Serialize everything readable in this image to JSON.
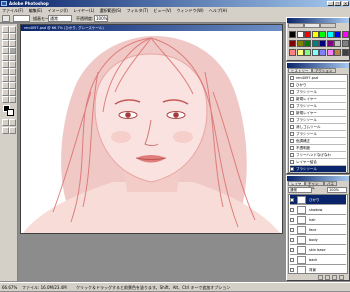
{
  "window": {
    "title": "Adobe Photoshop"
  },
  "menu": [
    "ファイル(F)",
    "編集(E)",
    "イメージ(I)",
    "レイヤー(L)",
    "選択範囲(S)",
    "フィルタ(T)",
    "ビュー(V)",
    "ウィンドウ(W)",
    "ヘルプ(H)"
  ],
  "options": {
    "mode_label": "描画モード:",
    "mode_value": "通常",
    "opacity_label": "不透明度:",
    "opacity_value": "100%"
  },
  "document": {
    "title": "ren4097.psd @ 66.7% (ひかり, グレースケール)"
  },
  "swatches": [
    "#000000",
    "#ffffff",
    "#ff0000",
    "#ffff00",
    "#00ff00",
    "#00ffff",
    "#0000ff",
    "#ff00ff",
    "#800000",
    "#808000",
    "#008000",
    "#008080",
    "#000080",
    "#800080",
    "#c0c0c0",
    "#808080",
    "#ff8080",
    "#ffff80",
    "#80ff80",
    "#80ffff",
    "#8080ff",
    "#ff80ff",
    "#c08040",
    "#404040"
  ],
  "history": {
    "tabs": [
      "ヒストリー",
      "アクション"
    ],
    "items": [
      "ren4097.psd",
      "ひかり",
      "ブラシツール",
      "新規レイヤー",
      "ブラシツール",
      "新規レイヤー",
      "ブラシツール",
      "消しゴムツール",
      "ブラシツール",
      "色調補正",
      "不透明度",
      "フリーハンドなげなわ",
      "レイヤー結合",
      "ブラシツール"
    ]
  },
  "layers": {
    "tabs": [
      "レイヤー",
      "チャンネル",
      "パス"
    ],
    "mode": "通常",
    "opacity": "100%",
    "items": [
      "ひかり",
      "shadow",
      "hair",
      "face",
      "body",
      "skin base",
      "back",
      "背景"
    ]
  },
  "status": {
    "zoom": "66.67%",
    "doc": "ファイル: 16.0M/23.4M",
    "hint": "クリック＆ドラッグすると前景色を塗ります。Shift、Alt、Ctrl キーで追加オプション"
  }
}
